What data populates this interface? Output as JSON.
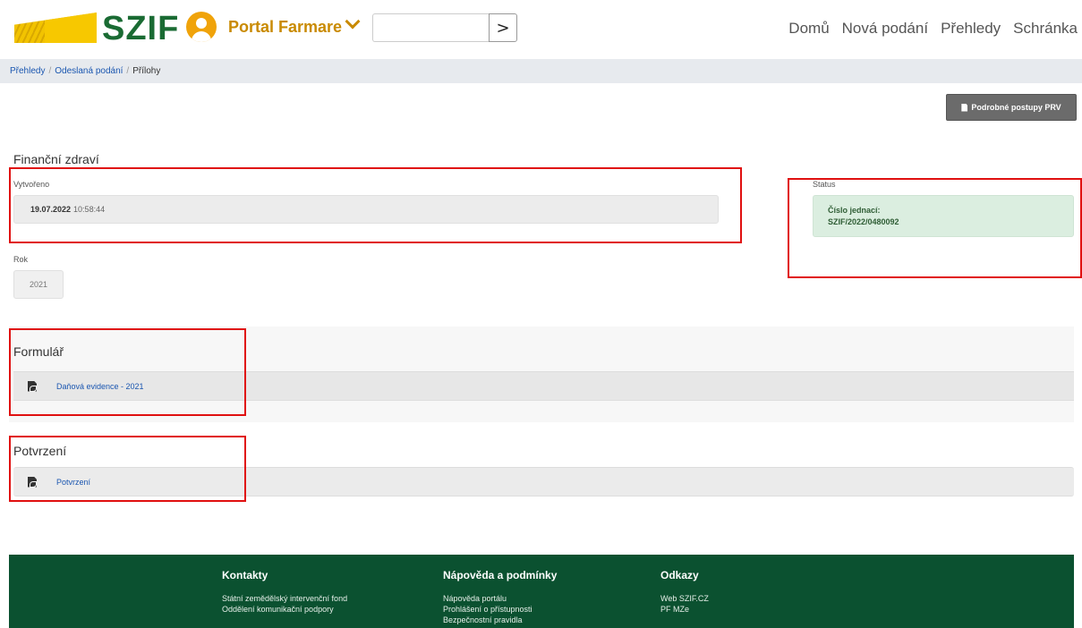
{
  "header": {
    "logo_text": "SZIF",
    "portal_label": "Portal Farmare",
    "search": {
      "value": "",
      "placeholder": ""
    },
    "search_button_glyph": ">",
    "nav": [
      "Domů",
      "Nová podání",
      "Přehledy",
      "Schránka"
    ]
  },
  "breadcrumb": {
    "items": [
      "Přehledy",
      "Odeslaná podání"
    ],
    "current": "Přílohy"
  },
  "procedures_button": {
    "label": "Podrobné postupy PRV"
  },
  "main": {
    "title": "Finanční zdraví",
    "created": {
      "label": "Vytvořeno",
      "date": "19.07.2022",
      "time": "10:58:44"
    },
    "year": {
      "label": "Rok",
      "value": "2021"
    },
    "status": {
      "label": "Status",
      "line1": "Číslo jednací:",
      "line2": "SZIF/2022/0480092"
    }
  },
  "form_section": {
    "title": "Formulář",
    "documents": [
      {
        "label": "Daňová evidence - 2021",
        "icon": "pdf-icon"
      }
    ]
  },
  "confirmation_section": {
    "title": "Potvrzení",
    "documents": [
      {
        "label": "Potvrzení",
        "icon": "pdf-icon"
      }
    ]
  },
  "footer": {
    "columns": [
      {
        "title": "Kontakty",
        "links": [
          "Státní zemědělský intervenční fond",
          "Oddělení komunikační podpory"
        ]
      },
      {
        "title": "Nápověda a podmínky",
        "links": [
          "Nápověda portálu",
          "Prohlášení o přístupnosti",
          "Bezpečnostní pravidla"
        ]
      },
      {
        "title": "Odkazy",
        "links": [
          "Web SZIF.CZ",
          "PF MZe"
        ]
      }
    ]
  },
  "colors": {
    "brand_green": "#1a6b33",
    "brand_yellow": "#f7c800",
    "portal_orange": "#c98a00",
    "footer_green": "#0b5130",
    "highlight_red": "#e01010",
    "status_bg": "#dbeee0"
  }
}
